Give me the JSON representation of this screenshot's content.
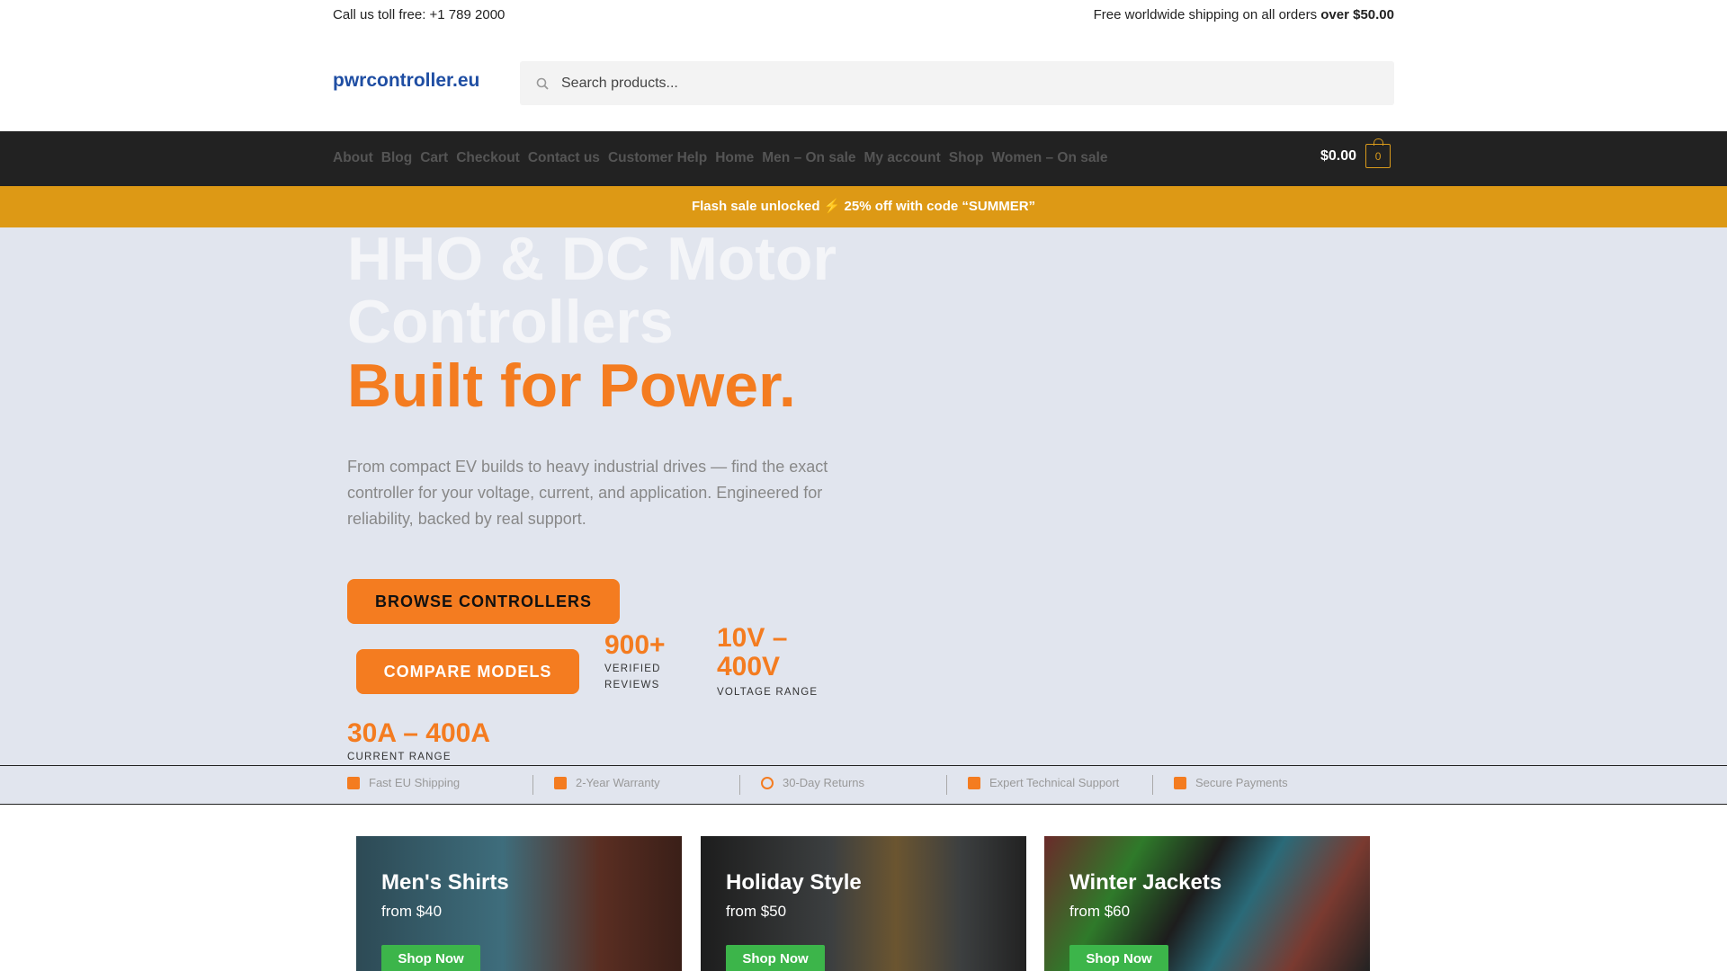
{
  "topbar": {
    "left": "Call us toll free: +1 789 2000",
    "right_prefix": "Free worldwide shipping on all orders ",
    "right_bold": "over $50.00"
  },
  "logo": "pwrcontroller.eu",
  "search": {
    "placeholder": "Search products...",
    "icon": "search-icon"
  },
  "nav": {
    "items": [
      "About",
      "Blog",
      "Cart",
      "Checkout",
      "Contact us",
      "Customer Help",
      "Home",
      "Men – On sale",
      "My account",
      "Shop",
      "Women – On sale"
    ],
    "cart_total": "$0.00",
    "cart_count": "0"
  },
  "flash": "Flash sale unlocked ⚡ 25% off with code “SUMMER”",
  "hero": {
    "line1": "HHO & DC Motor",
    "line2": "Controllers",
    "line3": "Built for Power.",
    "paragraph": "From compact EV builds to heavy industrial drives — find the exact controller for your voltage, current, and application. Engineered for reliability, backed by real support.",
    "browse": "BROWSE CONTROLLERS",
    "compare": "COMPARE MODELS",
    "stats": [
      {
        "value": "900+",
        "label": "VERIFIED REVIEWS"
      },
      {
        "value": "10V – 400V",
        "label": "VOLTAGE RANGE"
      },
      {
        "value": "30A – 400A",
        "label": "CURRENT RANGE"
      }
    ]
  },
  "features": [
    {
      "label": "Fast EU Shipping",
      "icon": "truck-icon"
    },
    {
      "label": "2-Year Warranty",
      "icon": "calendar-icon"
    },
    {
      "label": "30-Day Returns",
      "icon": "return-icon"
    },
    {
      "label": "Expert Technical Support",
      "icon": "toolbox-icon"
    },
    {
      "label": "Secure Payments",
      "icon": "credit-card-icon"
    }
  ],
  "cards": [
    {
      "title": "Men's Shirts",
      "price": "from $40",
      "button": "Shop Now"
    },
    {
      "title": "Holiday Style",
      "price": "from $50",
      "button": "Shop Now"
    },
    {
      "title": "Winter Jackets",
      "price": "from $60",
      "button": "Shop Now"
    }
  ],
  "colors": {
    "accent": "#f47c20",
    "flash": "#dd9915",
    "nav": "#222222",
    "hero_bg": "#e1e5ee",
    "shop_button": "#3cb54a",
    "logo": "#1f4ea3"
  }
}
